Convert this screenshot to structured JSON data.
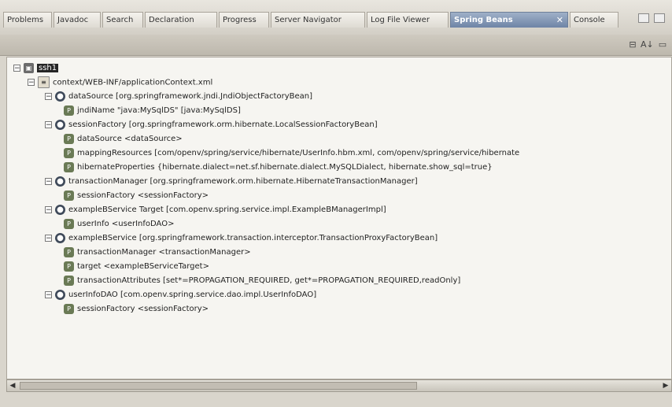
{
  "tabs": [
    {
      "label": "Problems",
      "active": false
    },
    {
      "label": "Javadoc",
      "active": false
    },
    {
      "label": "Search",
      "active": false
    },
    {
      "label": "Declaration",
      "active": false
    },
    {
      "label": "Progress",
      "active": false
    },
    {
      "label": "Server Navigator",
      "active": false
    },
    {
      "label": "Log File Viewer",
      "active": false
    },
    {
      "label": "Spring Beans",
      "active": true
    },
    {
      "label": "Console",
      "active": false
    }
  ],
  "toolbar": {
    "icons": [
      "collapse-all-icon",
      "sort-icon",
      "view-menu-icon"
    ]
  },
  "tree": {
    "project": "ssh1",
    "file": "context/WEB-INF/applicationContext.xml",
    "beans": [
      {
        "label": "dataSource [org.springframework.jndi.JndiObjectFactoryBean]",
        "props": [
          "jndiName \"java:MySqlDS\" [java:MySqlDS]"
        ]
      },
      {
        "label": "sessionFactory [org.springframework.orm.hibernate.LocalSessionFactoryBean]",
        "props": [
          "dataSource <dataSource>",
          "mappingResources [com/openv/spring/service/hibernate/UserInfo.hbm.xml, com/openv/spring/service/hibernate",
          "hibernateProperties {hibernate.dialect=net.sf.hibernate.dialect.MySQLDialect, hibernate.show_sql=true}"
        ]
      },
      {
        "label": "transactionManager [org.springframework.orm.hibernate.HibernateTransactionManager]",
        "props": [
          "sessionFactory <sessionFactory>"
        ]
      },
      {
        "label": "exampleBService Target [com.openv.spring.service.impl.ExampleBManagerImpl]",
        "props": [
          "userInfo <userInfoDAO>"
        ]
      },
      {
        "label": "exampleBService [org.springframework.transaction.interceptor.TransactionProxyFactoryBean]",
        "props": [
          "transactionManager <transactionManager>",
          "target <exampleBServiceTarget>",
          "transactionAttributes [set*=PROPAGATION_REQUIRED, get*=PROPAGATION_REQUIRED,readOnly]"
        ]
      },
      {
        "label": "userInfoDAO [com.openv.spring.service.dao.impl.UserInfoDAO]",
        "props": [
          "sessionFactory <sessionFactory>"
        ]
      }
    ]
  }
}
